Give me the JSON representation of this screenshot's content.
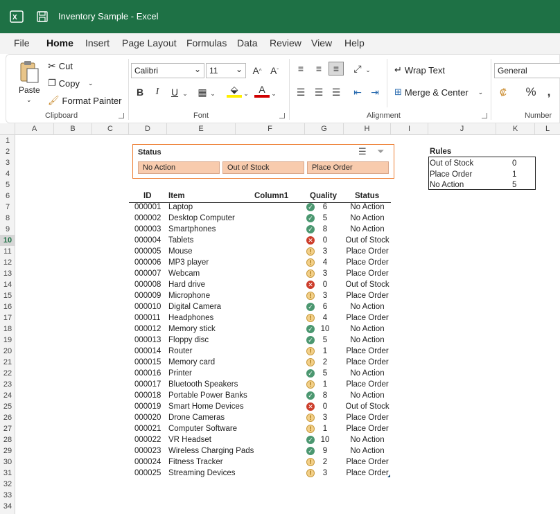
{
  "window": {
    "title": "Inventory Sample  -  Excel"
  },
  "menu": [
    "File",
    "Home",
    "Insert",
    "Page Layout",
    "Formulas",
    "Data",
    "Review",
    "View",
    "Help"
  ],
  "ribbon": {
    "clipboard": {
      "label": "Clipboard",
      "paste": "Paste",
      "cut": "Cut",
      "copy": "Copy",
      "format_painter": "Format Painter"
    },
    "font": {
      "label": "Font",
      "name": "Calibri",
      "size": "11"
    },
    "alignment": {
      "label": "Alignment",
      "wrap": "Wrap Text",
      "merge": "Merge & Center"
    },
    "number": {
      "label": "Number",
      "format": "General"
    }
  },
  "columns": [
    "A",
    "B",
    "C",
    "D",
    "E",
    "F",
    "G",
    "H",
    "I",
    "J",
    "K",
    "L"
  ],
  "rows": [
    "1",
    "2",
    "3",
    "4",
    "5",
    "6",
    "7",
    "8",
    "9",
    "10",
    "11",
    "12",
    "13",
    "14",
    "15",
    "16",
    "17",
    "18",
    "19",
    "20",
    "21",
    "22",
    "23",
    "24",
    "25",
    "26",
    "27",
    "28",
    "29",
    "30",
    "31",
    "32",
    "33",
    "34"
  ],
  "selected_row": "10",
  "slicer": {
    "title": "Status",
    "options": [
      "No Action",
      "Out of Stock",
      "Place Order"
    ]
  },
  "table": {
    "headers": {
      "id": "ID",
      "item": "Item",
      "col1": "Column1",
      "quality": "Quality",
      "status": "Status"
    },
    "rows": [
      {
        "id": "000001",
        "item": "Laptop",
        "q": "6",
        "s": "No Action",
        "icon": "ok"
      },
      {
        "id": "000002",
        "item": "Desktop Computer",
        "q": "5",
        "s": "No Action",
        "icon": "ok"
      },
      {
        "id": "000003",
        "item": "Smartphones",
        "q": "8",
        "s": "No Action",
        "icon": "ok"
      },
      {
        "id": "000004",
        "item": "Tablets",
        "q": "0",
        "s": "Out of Stock",
        "icon": "bad"
      },
      {
        "id": "000005",
        "item": "Mouse",
        "q": "3",
        "s": "Place Order",
        "icon": "warn"
      },
      {
        "id": "000006",
        "item": "MP3 player",
        "q": "4",
        "s": "Place Order",
        "icon": "warn"
      },
      {
        "id": "000007",
        "item": "Webcam",
        "q": "3",
        "s": "Place Order",
        "icon": "warn"
      },
      {
        "id": "000008",
        "item": "Hard drive",
        "q": "0",
        "s": "Out of Stock",
        "icon": "bad"
      },
      {
        "id": "000009",
        "item": "Microphone",
        "q": "3",
        "s": "Place Order",
        "icon": "warn"
      },
      {
        "id": "000010",
        "item": "Digital Camera",
        "q": "6",
        "s": "No Action",
        "icon": "ok"
      },
      {
        "id": "000011",
        "item": "Headphones",
        "q": "4",
        "s": "Place Order",
        "icon": "warn"
      },
      {
        "id": "000012",
        "item": "Memory stick",
        "q": "10",
        "s": "No Action",
        "icon": "ok"
      },
      {
        "id": "000013",
        "item": "Floppy disc",
        "q": "5",
        "s": "No Action",
        "icon": "ok"
      },
      {
        "id": "000014",
        "item": "Router",
        "q": "1",
        "s": "Place Order",
        "icon": "warn"
      },
      {
        "id": "000015",
        "item": "Memory card",
        "q": "2",
        "s": "Place Order",
        "icon": "warn"
      },
      {
        "id": "000016",
        "item": "Printer",
        "q": "5",
        "s": "No Action",
        "icon": "ok"
      },
      {
        "id": "000017",
        "item": "Bluetooth Speakers",
        "q": "1",
        "s": "Place Order",
        "icon": "warn"
      },
      {
        "id": "000018",
        "item": "Portable Power Banks",
        "q": "8",
        "s": "No Action",
        "icon": "ok"
      },
      {
        "id": "000019",
        "item": "Smart Home Devices",
        "q": "0",
        "s": "Out of Stock",
        "icon": "bad"
      },
      {
        "id": "000020",
        "item": "Drone Cameras",
        "q": "3",
        "s": "Place Order",
        "icon": "warn"
      },
      {
        "id": "000021",
        "item": "Computer Software",
        "q": "1",
        "s": "Place Order",
        "icon": "warn"
      },
      {
        "id": "000022",
        "item": "VR Headset",
        "q": "10",
        "s": "No Action",
        "icon": "ok"
      },
      {
        "id": "000023",
        "item": "Wireless Charging Pads",
        "q": "9",
        "s": "No Action",
        "icon": "ok"
      },
      {
        "id": "000024",
        "item": "Fitness Tracker",
        "q": "2",
        "s": "Place Order",
        "icon": "warn"
      },
      {
        "id": "000025",
        "item": "Streaming Devices",
        "q": "3",
        "s": "Place Order",
        "icon": "warn"
      }
    ]
  },
  "rules": {
    "title": "Rules",
    "items": [
      {
        "label": "Out of Stock",
        "value": "0"
      },
      {
        "label": "Place Order",
        "value": "1"
      },
      {
        "label": "No Action",
        "value": "5"
      }
    ]
  }
}
